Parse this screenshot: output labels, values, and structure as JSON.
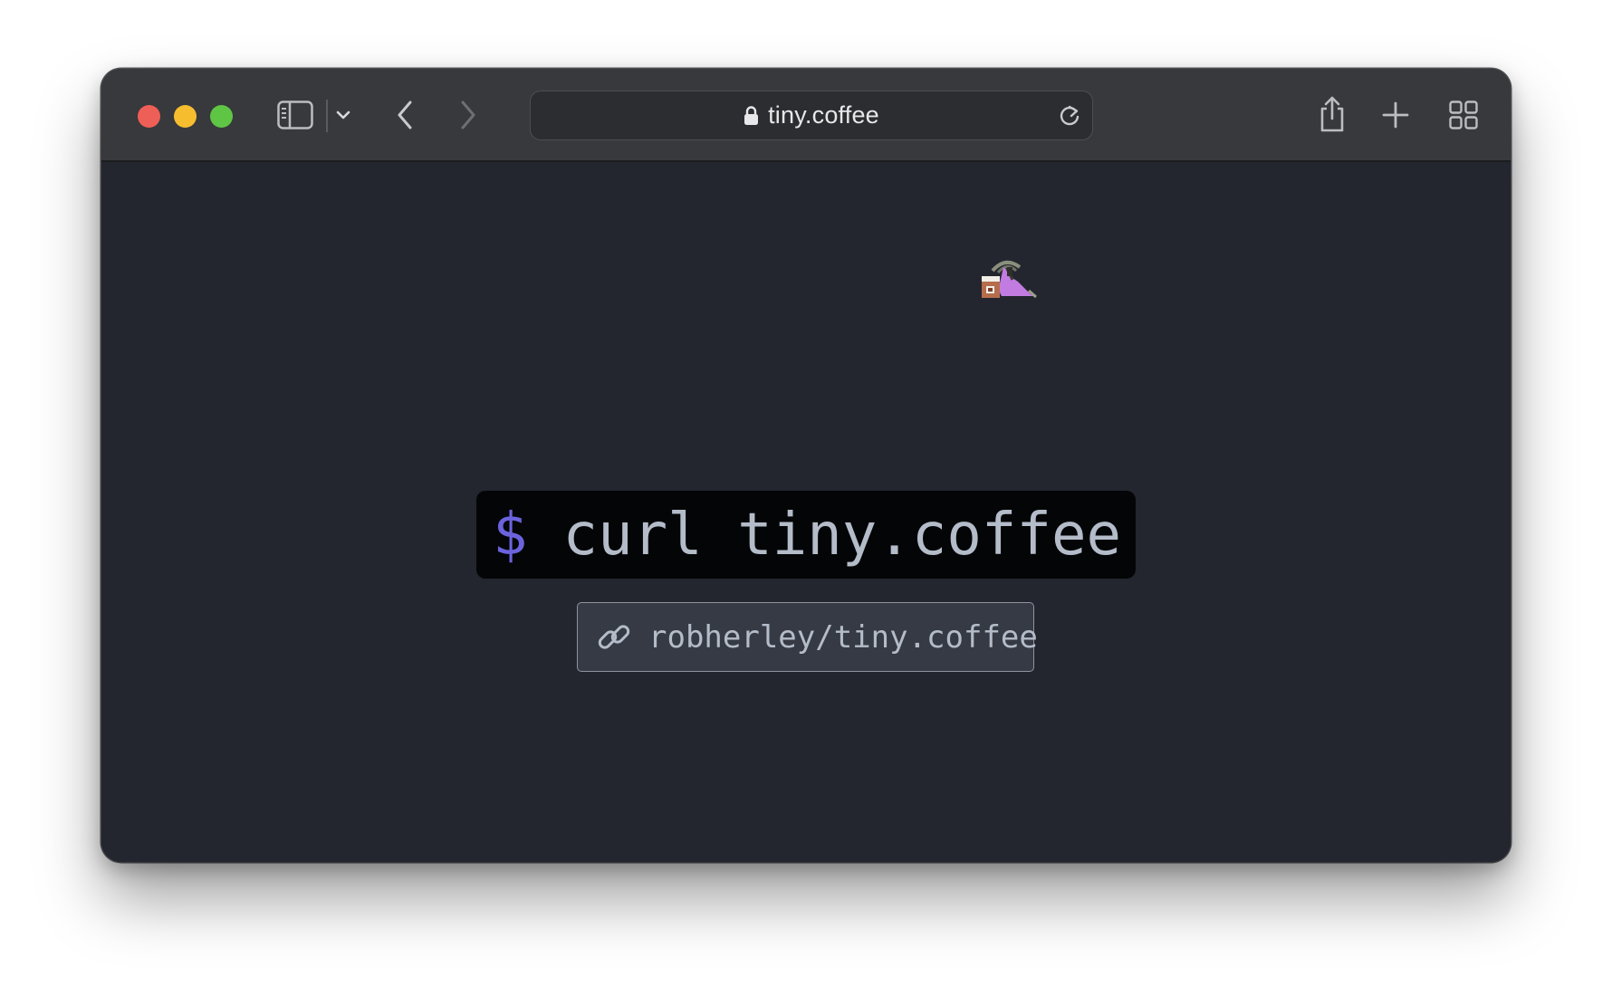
{
  "browser": {
    "url": "tiny.coffee",
    "icons": {
      "sidebar_toggle": "sidebar-icon",
      "sidebar_menu": "chevron-down-icon",
      "back": "chevron-left-icon",
      "forward": "chevron-right-icon",
      "lock": "lock-icon",
      "reload": "reload-icon",
      "share": "share-icon",
      "new_tab": "plus-icon",
      "tab_overview": "grid-icon"
    },
    "traffic_lights": {
      "close": "#ee5f57",
      "minimize": "#f6be2f",
      "zoom": "#5fc645"
    }
  },
  "page": {
    "mascot": "coffee-mascot-icon",
    "command": {
      "prompt": "$",
      "text": "curl tiny.coffee"
    },
    "repo_link": {
      "icon": "link-icon",
      "label": "robherley/tiny.coffee"
    },
    "colors": {
      "background": "#23262e",
      "prompt": "#6b63dd",
      "command_text": "#b4bcc9",
      "command_box": "#040506",
      "link_box": "#363a44"
    }
  }
}
